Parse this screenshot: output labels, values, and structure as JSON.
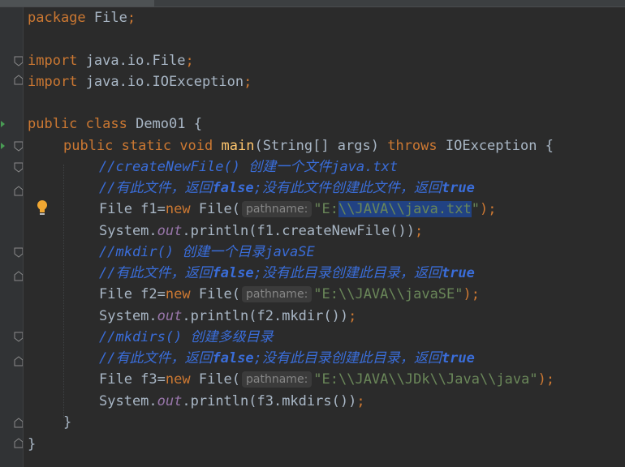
{
  "lines": {
    "l1": {
      "kw": "package",
      "name": " File",
      "semi": ";"
    },
    "l2": {
      "kw": "import",
      "pkg": " java.io.File",
      "semi": ";"
    },
    "l3": {
      "kw": "import",
      "pkg": " java.io.IOException",
      "semi": ";"
    },
    "l4": {
      "kw1": "public",
      "kw2": " class",
      "name": " Demo01 {"
    },
    "l5": {
      "kw1": "public",
      "kw2": " static",
      "kw3": " void",
      "fn": " main",
      "params": "(String[] args)",
      "kw4": " throws",
      "rest": " IOException {"
    },
    "c1": "//createNewFile() 创建一个文件java.txt",
    "c2a": "//有此文件，返回",
    "c2b": "false",
    "c2c": ";没有此文件创建此文件，返回",
    "c2d": "true",
    "f1": {
      "decl": "File f1=",
      "kw": "new",
      "ctor": " File(",
      "hint": "pathname:",
      "q1": "\"E:",
      "sel": "\\\\JAVA\\\\java.txt",
      "q2": "\"",
      "end": ");"
    },
    "p1": {
      "a": "System.",
      "field": "out",
      "b": ".println(f1.createNewFile())",
      "semi": ";"
    },
    "c3": "//mkdir() 创建一个目录javaSE",
    "c4a": "//有此文件，返回",
    "c4b": "false",
    "c4c": ";没有此目录创建此目录，返回",
    "c4d": "true",
    "f2": {
      "decl": "File f2=",
      "kw": "new",
      "ctor": " File(",
      "hint": "pathname:",
      "str": "\"E:\\\\JAVA\\\\javaSE\"",
      "end": ");"
    },
    "p2": {
      "a": "System.",
      "field": "out",
      "b": ".println(f2.mkdir())",
      "semi": ";"
    },
    "c5": "//mkdirs() 创建多级目录",
    "c6a": "//有此文件，返回",
    "c6b": "false",
    "c6c": ";没有此目录创建此目录，返回",
    "c6d": "true",
    "f3": {
      "decl": "File f3=",
      "kw": "new",
      "ctor": " File(",
      "hint": "pathname:",
      "str": "\"E:\\\\JAVA\\\\JDk\\\\Java\\\\java\"",
      "end": ");"
    },
    "p3": {
      "a": "System.",
      "field": "out",
      "b": ".println(f3.mkdirs())",
      "semi": ";"
    },
    "close1": "}",
    "close2": "}"
  },
  "icons": [
    "fold-icon",
    "run-arrow-icon",
    "intention-bulb-icon"
  ],
  "colors": {
    "background": "#2b2b2b",
    "keyword": "#cc7832",
    "string": "#6a8759",
    "comment": "#3a6dd9",
    "function": "#ffc66d",
    "field": "#9876aa",
    "selection": "#214283"
  }
}
